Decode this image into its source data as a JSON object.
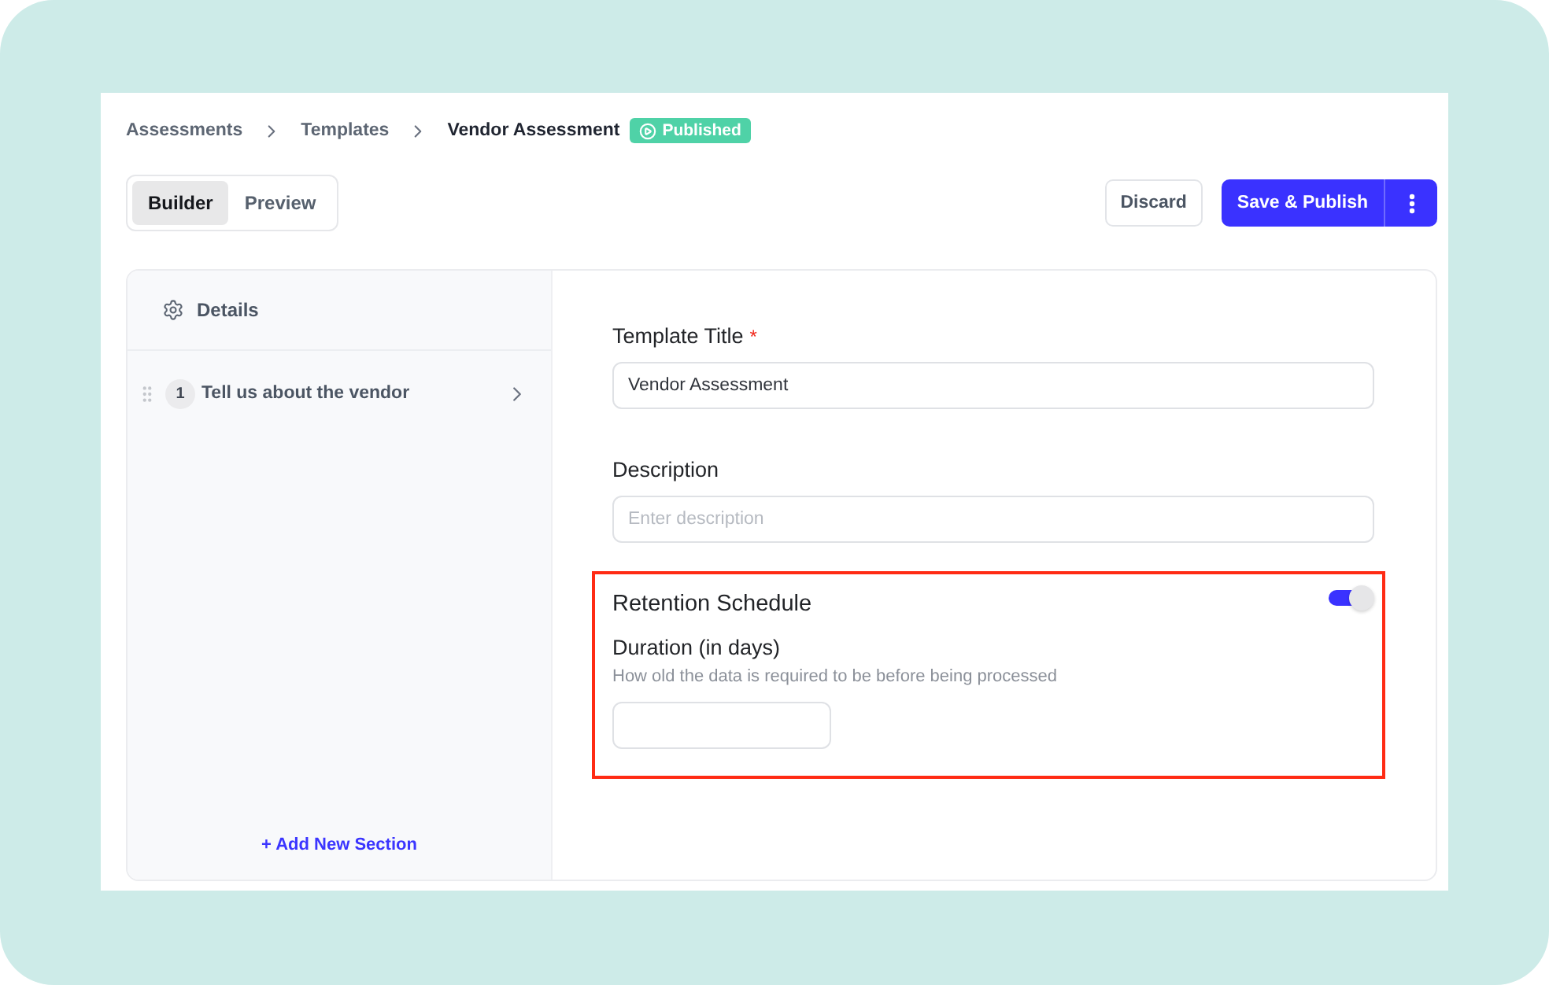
{
  "breadcrumb": [
    {
      "label": "Assessments",
      "current": false
    },
    {
      "label": "Templates",
      "current": false
    },
    {
      "label": "Vendor Assessment",
      "current": true
    }
  ],
  "status_badge": "Published",
  "view_tabs": [
    {
      "label": "Builder",
      "selected": true
    },
    {
      "label": "Preview",
      "selected": false
    }
  ],
  "actions": {
    "discard": "Discard",
    "primary": "Save & Publish"
  },
  "sidebar": {
    "details": "Details",
    "sections": [
      {
        "number": "1",
        "title": "Tell us about the vendor"
      }
    ],
    "add_section": "+ Add New Section"
  },
  "form": {
    "title_field": {
      "label": "Template Title",
      "required_mark": "*",
      "value": "Vendor Assessment"
    },
    "description_field": {
      "label": "Description",
      "placeholder": "Enter description"
    },
    "retention": {
      "title": "Retention Schedule",
      "on": true,
      "highlighted": true,
      "duration_label": "Duration (in days)",
      "help": "How old the data is required to be before being processed"
    }
  }
}
